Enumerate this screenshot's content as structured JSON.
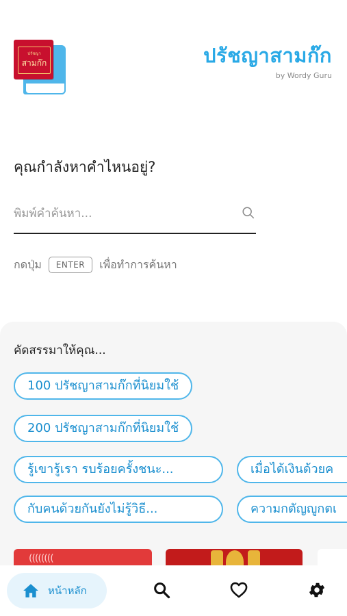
{
  "app": {
    "title": "ปรัชญาสามก๊ก",
    "subtitle": "by Wordy Guru",
    "logo_small_text": "ปรัชญา",
    "logo_main_text": "สามก๊ก"
  },
  "search": {
    "heading": "คุณกำลังหาคำไหนอยู่?",
    "placeholder": "พิมพ์คำค้นหา...",
    "value": "",
    "hint_before": "กดปุ่ม",
    "hint_key": "ENTER",
    "hint_after": "เพื่อทำการค้นหา"
  },
  "recommend": {
    "title": "คัดสรรมาให้คุณ...",
    "chips": [
      "100 ปรัชญาสามก๊กที่นิยมใช้",
      "200 ปรัชญาสามก๊กที่นิยมใช้",
      "รู้เขารู้เรา รบร้อยครั้งชนะ...",
      "เมื่อได้เงินด้วยค",
      "กับคนด้วยกันยังไม่รู้วิธี...",
      "ความกตัญญูกตเ"
    ]
  },
  "nav": {
    "home_label": "หน้าหลัก",
    "items": [
      "home-icon",
      "search-icon",
      "heart-icon",
      "gear-icon"
    ]
  },
  "colors": {
    "accent": "#29a9e6",
    "chip_border": "#4fb6ea",
    "brand_red": "#c8102e"
  }
}
